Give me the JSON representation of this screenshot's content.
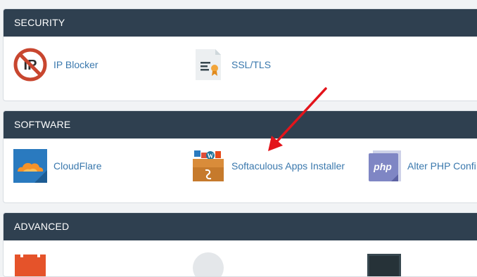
{
  "sections": [
    {
      "title": "SECURITY",
      "items": [
        {
          "label": "IP Blocker",
          "icon": "ip-blocker-icon"
        },
        {
          "label": "SSL/TLS",
          "icon": "ssl-certificate-icon"
        }
      ]
    },
    {
      "title": "SOFTWARE",
      "items": [
        {
          "label": "CloudFlare",
          "icon": "cloudflare-icon"
        },
        {
          "label": "Softaculous Apps Installer",
          "icon": "softaculous-box-icon"
        },
        {
          "label": "Alter PHP Confi",
          "icon": "php-icon"
        }
      ]
    },
    {
      "title": "ADVANCED",
      "items": []
    }
  ],
  "colors": {
    "header_bg": "#2f4050",
    "link": "#3a78ad",
    "annotation_arrow": "#e3141b"
  }
}
